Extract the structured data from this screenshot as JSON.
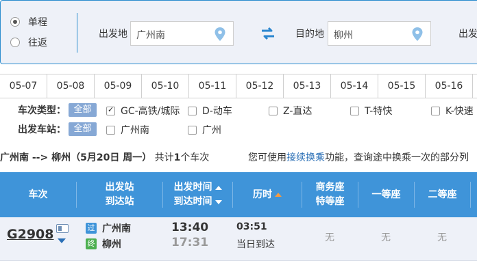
{
  "trip_type": {
    "one_way": "单程",
    "round_trip": "往返",
    "selected": "单程"
  },
  "search": {
    "from_label": "出发地",
    "from_value": "广州南",
    "to_label": "目的地",
    "to_value": "柳州",
    "date_label_partial": "出发"
  },
  "dates": [
    "05-07",
    "05-08",
    "05-09",
    "05-10",
    "05-11",
    "05-12",
    "05-13",
    "05-14",
    "05-15",
    "05-16"
  ],
  "filters": {
    "type_label": "车次类型：",
    "station_label": "出发车站：",
    "all_label": "全部",
    "types": [
      {
        "label": "GC-高铁/城际",
        "checked": true
      },
      {
        "label": "D-动车",
        "checked": false
      },
      {
        "label": "Z-直达",
        "checked": false
      },
      {
        "label": "T-特快",
        "checked": false
      },
      {
        "label": "K-快速",
        "checked": false
      }
    ],
    "stations": [
      {
        "label": "广州南",
        "checked": false
      },
      {
        "label": "广州",
        "checked": false
      }
    ]
  },
  "summary": {
    "route": "广州南 --> 柳州（5月20日  周一）",
    "count_prefix": "共计",
    "count": "1",
    "count_suffix": "个车次",
    "hint_prefix": "您可使用",
    "hint_link": "接续换乘",
    "hint_suffix": "功能，查询途中换乘一次的部分列"
  },
  "table_header": {
    "train": "车次",
    "station_dep": "出发站",
    "station_arr": "到达站",
    "time_dep": "出发时间",
    "time_arr": "到达时间",
    "duration": "历时",
    "business_line1": "商务座",
    "business_line2": "特等座",
    "first_class": "一等座",
    "second_class": "二等座"
  },
  "result": {
    "train_no": "G2908",
    "dep_badge": "过",
    "arr_badge": "终",
    "dep_station": "广州南",
    "arr_station": "柳州",
    "dep_time": "13:40",
    "arr_time": "17:31",
    "duration": "03:51",
    "arrival_note": "当日到达",
    "business": "无",
    "first": "无",
    "second": "无"
  },
  "colors": {
    "accent_blue": "#3f94d9",
    "panel_bg": "#eef1f8",
    "link": "#2a6fb6",
    "sort_active": "#f79a3e",
    "badge_pass": "#3f94d9",
    "badge_end": "#4caf50"
  }
}
